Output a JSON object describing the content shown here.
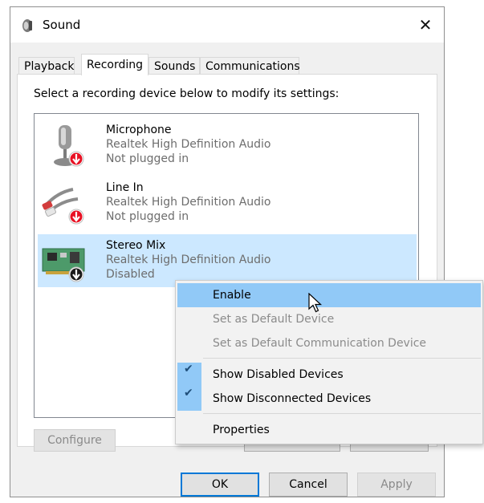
{
  "window": {
    "title": "Sound",
    "close_glyph": "✕"
  },
  "tabs": [
    {
      "label": "Playback",
      "active": false
    },
    {
      "label": "Recording",
      "active": true
    },
    {
      "label": "Sounds",
      "active": false
    },
    {
      "label": "Communications",
      "active": false
    }
  ],
  "panel": {
    "instruction": "Select a recording device below to modify its settings:"
  },
  "devices": [
    {
      "name": "Microphone",
      "driver": "Realtek High Definition Audio",
      "status": "Not plugged in",
      "icon": "microphone-icon",
      "badge": "red-down-arrow"
    },
    {
      "name": "Line In",
      "driver": "Realtek High Definition Audio",
      "status": "Not plugged in",
      "icon": "line-in-cable-icon",
      "badge": "red-down-arrow"
    },
    {
      "name": "Stereo Mix",
      "driver": "Realtek High Definition Audio",
      "status": "Disabled",
      "icon": "sound-card-icon",
      "badge": "black-down-arrow",
      "selected": true
    }
  ],
  "buttons": {
    "configure": "Configure",
    "ok": "OK",
    "cancel": "Cancel",
    "apply": "Apply"
  },
  "context_menu": {
    "items": [
      {
        "label": "Enable",
        "state": "hover"
      },
      {
        "label": "Set as Default Device",
        "state": "disabled"
      },
      {
        "label": "Set as Default Communication Device",
        "state": "disabled"
      },
      {
        "label": "Show Disabled Devices",
        "checked": true
      },
      {
        "label": "Show Disconnected Devices",
        "checked": true
      },
      {
        "label": "Properties"
      }
    ],
    "check_glyph": "✔"
  },
  "colors": {
    "selection": "#cce8ff",
    "menu_hover": "#91c9f7",
    "default_button_border": "#0078d7",
    "badge_red": "#e81123"
  }
}
